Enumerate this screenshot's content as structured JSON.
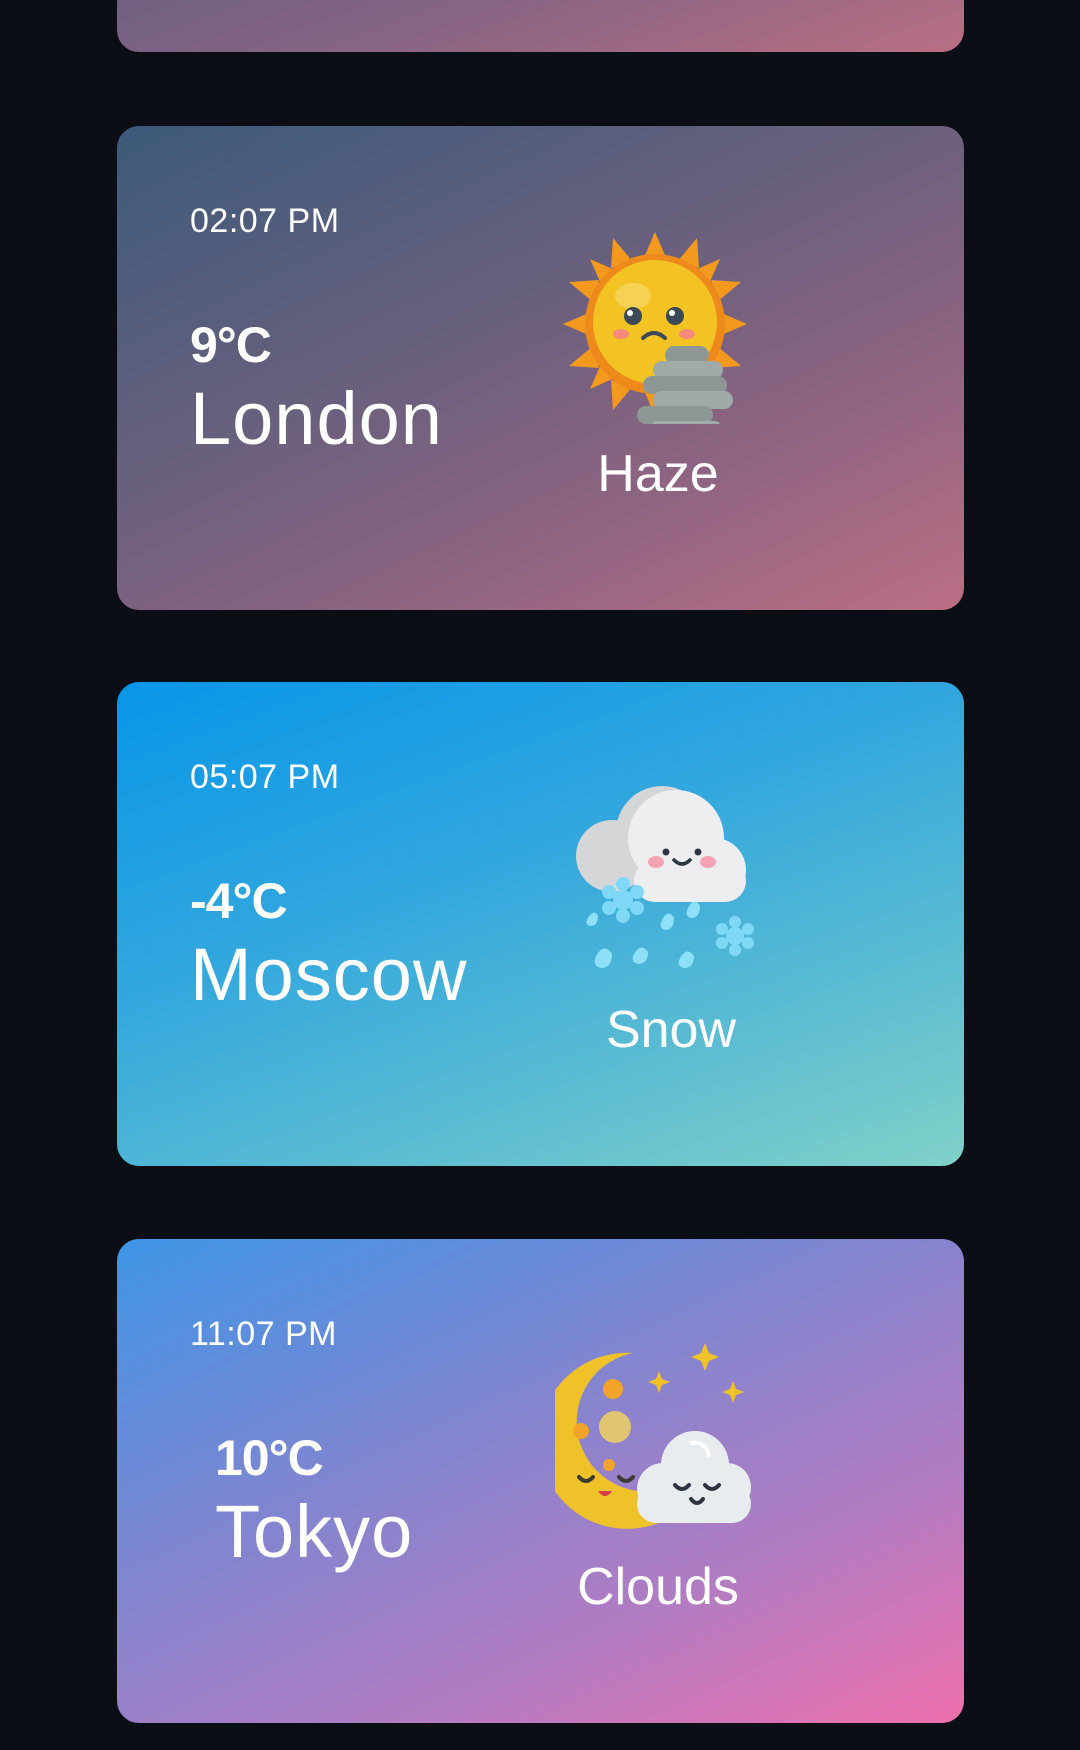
{
  "cards": [
    {
      "time": "02:07 PM",
      "temperature": "9°C",
      "city": "London",
      "condition": "Haze",
      "icon": "sun-haze-icon"
    },
    {
      "time": "05:07 PM",
      "temperature": "-4°C",
      "city": "Moscow",
      "condition": "Snow",
      "icon": "snow-cloud-icon"
    },
    {
      "time": "11:07 PM",
      "temperature": "10°C",
      "city": "Tokyo",
      "condition": "Clouds",
      "icon": "moon-cloud-icon"
    }
  ],
  "colors": {
    "background": "#0b0e14",
    "text": "#ffffff"
  }
}
